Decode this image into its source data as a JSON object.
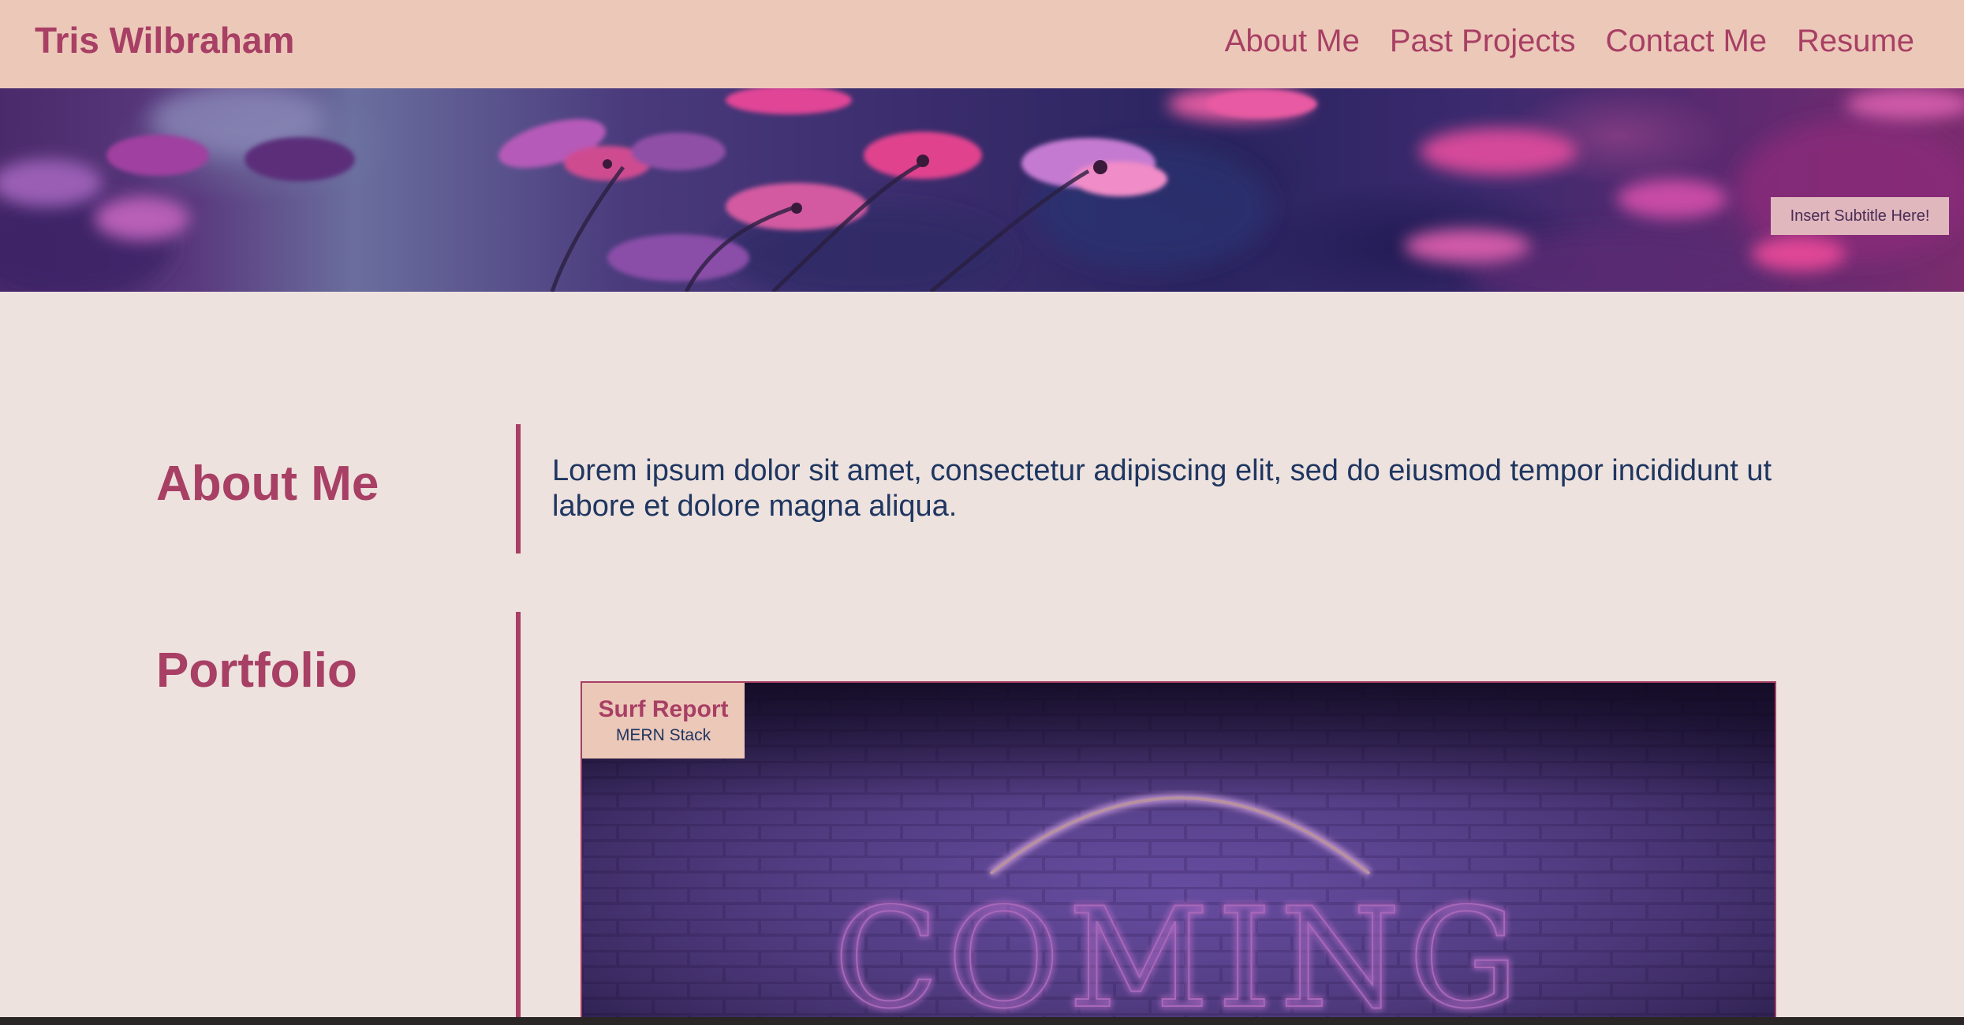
{
  "header": {
    "brand": "Tris Wilbraham",
    "nav": [
      "About Me",
      "Past Projects",
      "Contact Me",
      "Resume"
    ]
  },
  "hero": {
    "subtitle_button": "Insert Subtitle Here!"
  },
  "about": {
    "title": "About Me",
    "text": "Lorem ipsum dolor sit amet, consectetur adipiscing elit, sed do eiusmod tempor incididunt ut labore et dolore magna aliqua."
  },
  "portfolio": {
    "title": "Portfolio",
    "projects": [
      {
        "title": "Surf Report",
        "stack": "MERN Stack",
        "image_text": "COMING"
      }
    ]
  },
  "colors": {
    "header_bg": "#ecc8b9",
    "page_bg": "#ede2de",
    "accent": "#a83f64",
    "text_dark": "#1f3660"
  }
}
